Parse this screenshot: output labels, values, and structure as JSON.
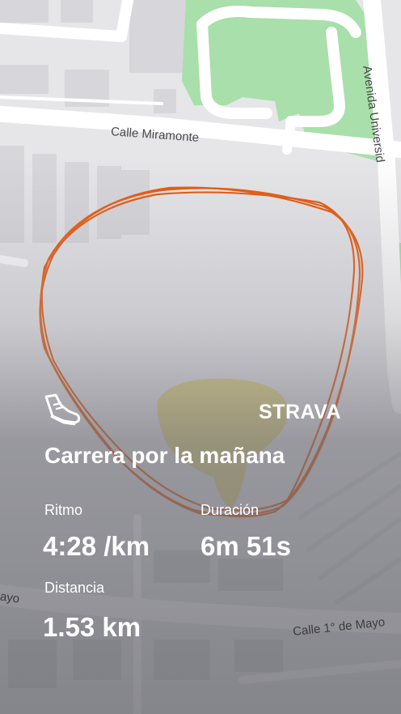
{
  "map": {
    "streets": {
      "calle_miramonte": "Calle Miramonte",
      "avenida": "Avenida Universid",
      "calle_mayo": "Calle 1° de Mayo",
      "mayo_fragment": "ayo"
    },
    "route_color": "#e8590c"
  },
  "activity": {
    "title": "Carrera por la mañana",
    "brand": "STRAVA",
    "icon": "running-shoe-icon",
    "stats": {
      "pace_label": "Ritmo",
      "pace_value": "4:28 /km",
      "duration_label": "Duración",
      "duration_value": "6m 51s",
      "distance_label": "Distancia",
      "distance_value": "1.53 km"
    }
  },
  "colors": {
    "park": "#9fe0a0",
    "sand": "#d8cc6a",
    "road": "#ffffff",
    "text": "#ffffff"
  }
}
